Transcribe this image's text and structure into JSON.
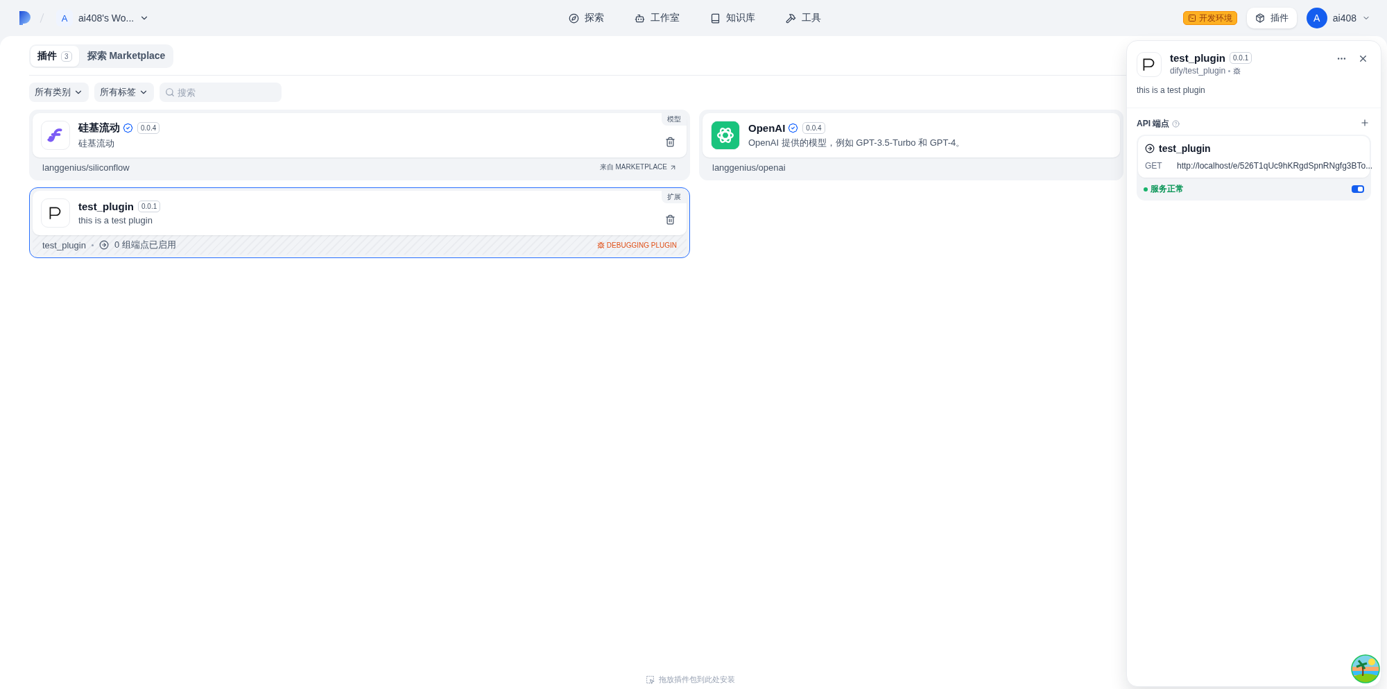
{
  "topbar": {
    "workspace": {
      "initial": "A",
      "name": "ai408's Wo..."
    },
    "nav": [
      {
        "kind": "explore",
        "label": "探索"
      },
      {
        "kind": "studio",
        "label": "工作室"
      },
      {
        "kind": "knowledge",
        "label": "知识库"
      },
      {
        "kind": "tools",
        "label": "工具"
      }
    ],
    "env_badge": "开发环境",
    "plugins_button": "插件",
    "user": {
      "initial": "A",
      "name": "ai408"
    }
  },
  "tabs": [
    {
      "label": "插件",
      "count": "3",
      "selected": true
    },
    {
      "label": "探索 Marketplace",
      "selected": false
    }
  ],
  "filters": {
    "category": "所有类别",
    "tag": "所有标签",
    "search_placeholder": "搜索"
  },
  "plugins": [
    {
      "logo": {
        "kind": "siliconflow"
      },
      "name": "硅基流动",
      "verified": true,
      "version": "0.0.4",
      "description": "硅基流动",
      "category": "模型",
      "deletable": true,
      "source": "langgenius/siliconflow",
      "kind": "marketplace",
      "origin": "来自 MARKETPLACE",
      "selected": false
    },
    {
      "logo": {
        "kind": "openai"
      },
      "name": "OpenAI",
      "verified": true,
      "version": "0.0.4",
      "description": "OpenAI 提供的模型，例如 GPT-3.5-Turbo 和 GPT-4。",
      "source": "langgenius/openai",
      "kind": "marketplace",
      "selected": false
    },
    {
      "logo": {
        "kind": "letter"
      },
      "name": "test_plugin",
      "verified": false,
      "version": "0.0.1",
      "description": "this is a test plugin",
      "category": "扩展",
      "deletable": true,
      "source": "test_plugin",
      "kind": "debugging",
      "endpoints_info": "0 组端点已启用",
      "origin": "DEBUGGING PLUGIN",
      "selected": true
    }
  ],
  "dropzone_hint": "拖放插件包到此处安装",
  "panel": {
    "name": "test_plugin",
    "version": "0.0.1",
    "author": "dify/test_plugin",
    "description": "this is a test plugin",
    "endpoints_title": "API 端点",
    "endpoints": [
      {
        "name": "test_plugin",
        "method": "GET",
        "url": "http://localhost/e/526T1qUc9hKRgdSpnRNgfg3BTo...",
        "status": "服务正常",
        "healthy": true,
        "enabled": true
      }
    ]
  }
}
